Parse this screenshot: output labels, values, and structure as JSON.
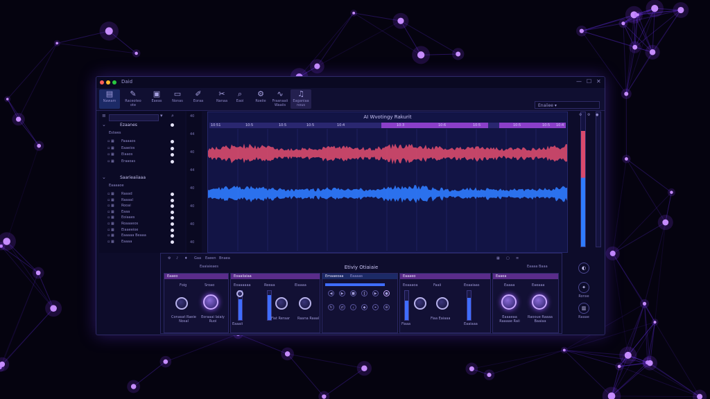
{
  "window": {
    "title": "Daid",
    "controls": [
      "—",
      "☐",
      "✕"
    ]
  },
  "toolbar": {
    "tools": [
      {
        "label": "Nawam",
        "icon": "file-icon",
        "glyph": "▤"
      },
      {
        "label": "Raceoteo ote",
        "icon": "edit-icon",
        "glyph": "✎"
      },
      {
        "label": "Eaeas",
        "icon": "layers-icon",
        "glyph": "▣"
      },
      {
        "label": "Nonas",
        "icon": "monitor-icon",
        "glyph": "▭"
      },
      {
        "label": "Eoraa",
        "icon": "brush-icon",
        "glyph": "✐"
      },
      {
        "label": "Nanaa",
        "icon": "scissors-icon",
        "glyph": "✂"
      },
      {
        "label": "Eaoi",
        "icon": "search-icon",
        "glyph": "⌕"
      },
      {
        "label": "Roeiie",
        "icon": "gear-icon",
        "glyph": "⚙"
      },
      {
        "label": "Fraanaaii Waaiis",
        "icon": "wave-icon",
        "glyph": "∿"
      },
      {
        "label": "Eaganiaa nous",
        "icon": "music-icon",
        "glyph": "♫"
      }
    ],
    "preset_label": "Enaiiee"
  },
  "sidebar": {
    "groups": [
      {
        "name": "Ezaanes",
        "sub": "Estwes",
        "items": [
          "Faaaaos",
          "Eaaeios",
          "Eiaaos",
          "Eraaoas"
        ]
      },
      {
        "name": "Saarieaiiaaa",
        "sub": "Eaaaaoe",
        "items": [
          "Raaad",
          "Raaaal",
          "Rooai",
          "Eaaa",
          "Eoiaaes",
          "Roaaaeos",
          "Eiaaeeioe",
          "Eaaaaa Beaaa",
          "Eaaaa"
        ]
      }
    ]
  },
  "ruler": {
    "labels": [
      "40",
      "44",
      "40",
      "44",
      "40",
      "40",
      "40",
      "40"
    ]
  },
  "editor": {
    "title": "AI Wvotingy Rakurit",
    "timeline": [
      "10:51",
      "10:5",
      "10:5",
      "10:5",
      "10:4",
      "10:3",
      "10:6",
      "10:5",
      "10:5",
      "10:5",
      "10:4"
    ],
    "waveform_colors": {
      "top": "#d84a6c",
      "bottom": "#2f7bff"
    }
  },
  "mixer": {
    "tabs": [
      "Gaa",
      "Eaeen",
      "Bnaea"
    ],
    "title": "Etiviy Otiaiaie",
    "panel_labels": [
      "Eaaiaieaes",
      "Eaaaa Baaa"
    ],
    "strips": [
      {
        "head": "Eaaeo",
        "labels": [
          "Foig",
          "Sroao"
        ],
        "foot": [
          "Conasat Raeie Nosal",
          "Eoraaai Iaiaiy Ruoi"
        ]
      },
      {
        "head": "Eoaaiiaiaa",
        "labels": [
          "Eoaaaaaa",
          "Reeaa",
          "Eiaaaa"
        ],
        "foot": [
          "Eaaaii",
          "Fiat Reraar",
          "Raana Raaal"
        ]
      },
      {
        "head": "Emaaeoaa",
        "labels": [
          "Eaaaas"
        ],
        "foot": []
      },
      {
        "head": "Eaaaeo",
        "labels": [
          "Eoaaaoa",
          "Faaii",
          "Eoaaiaas"
        ],
        "foot": [
          "Fiaaa",
          "Fiaa Eaiaaa",
          "Eaaiaaa"
        ]
      },
      {
        "head": "Eaaea",
        "labels": [
          "Eaaaa",
          "Eaeaaa"
        ],
        "foot": [
          "Eaaaeaa Raaaae Raii",
          "Raooue Raaaa Baaiaa"
        ]
      }
    ]
  },
  "right_controls": [
    {
      "label": "",
      "glyph": "◐"
    },
    {
      "label": "Ronse",
      "glyph": "✦"
    },
    {
      "label": "Raaae",
      "glyph": "▥"
    }
  ],
  "meters": {
    "left_fill": 0.86,
    "left_color_top": "#d84a6c",
    "left_color_bottom": "#2f7bff"
  }
}
